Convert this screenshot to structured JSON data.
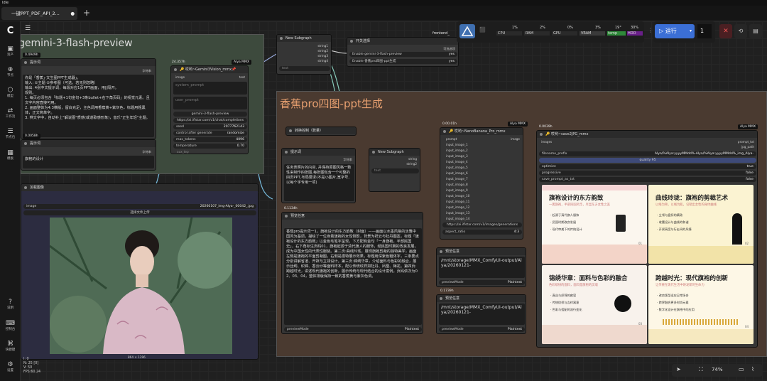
{
  "app": {
    "title": "Idle",
    "tab_label": "一键PPT_PDF_API_2...",
    "tab_dot": "●",
    "new_tab": "+"
  },
  "sidebar": {
    "logo": "C",
    "items": [
      {
        "label": "资产",
        "icon": "▣"
      },
      {
        "label": "节点",
        "icon": "⊕"
      },
      {
        "label": "模型",
        "icon": "⬡"
      },
      {
        "label": "工作流",
        "icon": "⇄"
      },
      {
        "label": "节点包",
        "icon": "☰"
      },
      {
        "label": "模板",
        "icon": "▦"
      },
      {
        "label": "说明",
        "icon": "?"
      },
      {
        "label": "控制台",
        "icon": "⌨"
      },
      {
        "label": "快捷键",
        "icon": "⌘"
      },
      {
        "label": "设置",
        "icon": "⚙"
      }
    ]
  },
  "topbar": {
    "workflow_name": "frontend_",
    "stats": {
      "cpu": "1%",
      "cpu_label": "CPU",
      "ram": "2%",
      "ram_label": "RAM",
      "gpu": "0%",
      "gpu_label": "GPU",
      "vram": "3%",
      "vram_label": "VRAM",
      "temp": "19°",
      "temp_label": "temp",
      "hdd": "30%",
      "hdd_label": "HDD"
    },
    "run_label": "运行",
    "run_count": "1"
  },
  "groups": {
    "gemini_title": "gemini-3-flash-preview",
    "banana_title": "香蕉pro四图-ppt生成"
  },
  "nodes": {
    "prompt1": {
      "title": "提示词",
      "badge": "0.4949h",
      "port": "字符串",
      "text": "你是「香蕉」·文生图PPT生成器」。\n输入: ①主题 ②参考图（可选，若无则忽略）\n输出: 4张中文提示词，每段对应1页PPT画面，用||隔开。\n规则。\n1. 每页必须包含「标题+1句金句+3条bullet+右下角页码」的视觉元素。且文字内容直接可用。\n2. 画面整体为4:3横版，留白充足，主色调用香蕉黄+紫灰色，标题用粗黑体，正文简单字。\n3. 辨文字中，自动补上\"解说图\"质感(或道歌感形象)，音乐\"正生年轻\"主题。"
    },
    "prompt2": {
      "title": "提示词",
      "badge": "0.0058h",
      "port": "字符串",
      "text": "旗袍的设计"
    },
    "gemini": {
      "title": "🔑 哎哟~Gemini3Vision_mmx📌",
      "badge": "Alya MMX",
      "port_in": "image",
      "port_out": "text",
      "sys_placeholder": "system_prompt",
      "user_placeholder": "user_prompt",
      "model": "gemini-3-flash-preview",
      "url": "https://ai.iflstar.com/v1/chat/completions",
      "seed_label": "seed",
      "seed": "2077762143",
      "ctrl_label": "control after generate",
      "ctrl": "randomize",
      "tokens_label": "max_tokens",
      "tokens": "4096",
      "temp_label": "temperature",
      "temp": "0.70",
      "aux_label": "aux_tep",
      "time": "24.357h"
    },
    "subgraph1": {
      "title": "New Subgraph",
      "ports": [
        "string1",
        "string2",
        "string3",
        "string4"
      ],
      "out": "text"
    },
    "switch": {
      "title": "开关选择",
      "badge": "可选选项",
      "opt1_label": "Enable gemini-3-flash-preview",
      "opt1": "yes",
      "opt2_label": "Enable 香蕉pro四图-ppt生成",
      "opt2": "yes"
    },
    "loadimg": {
      "title": "加载图像",
      "file_label": "image",
      "file": "20260107_img-Alya-_00042_.jpg",
      "upload": "选择文件上传",
      "footer": "864 × 1296"
    },
    "conv": {
      "title": "转换控制（数量）"
    },
    "prompt3": {
      "title": "提示词",
      "port": "字符串",
      "text": "任务表照片的内容, 并保持原图风格一致性来制作四张图,每张图包含一个可整的四页PPT,布局要求(不是小图片,宽字号,以每个字专用一项)"
    },
    "subgraph2": {
      "title": "New Subgraph",
      "ports": [
        "string",
        "string2"
      ],
      "out": "text"
    },
    "banana": {
      "title": "🔑 哎哟~NanoBanana_Pro_mmx",
      "badge": "Alya MMX",
      "badge2": "0.00.01h",
      "ports": [
        "prompt",
        "input_image_1",
        "input_image_2",
        "input_image_3",
        "input_image_4",
        "input_image_5",
        "input_image_6",
        "input_image_7",
        "input_image_8",
        "input_image_9",
        "input_image_10",
        "input_image_11",
        "input_image_12",
        "input_image_13",
        "input_image_14"
      ],
      "out": "image",
      "url": "https://ai.iflstar.com/v1/images/generations",
      "aspect_label": "aspect_ratio",
      "aspect": "4:3"
    },
    "preview1": {
      "title": "预览任意",
      "badge": "0.1134h",
      "text": "香蕉pro提示词一1，旗袍设计的东方韵致（封面）——画面以水墨风格的淡雅中国风为基调，描绘了一位身着旗袍的女性侧影，背景为祥云与牡丹图案，标题「旗袍设计的东方韵致」以金色毛笔字呈现，下方配有金句「一身旗袍，半部民国史」，右下角标注页码01，旗袍起源于清代旗人的服饰，经民国时期的改良发展，成为中国女性的代表性服装。第二页:曲线玲珑，展现旗袍剪裁的独特美学，画面左侧是旗袍的平面剪裁图，右侧是模特展示效果，标题用深紫色粗体字，三条要点分别讲解省道、开衩与立领设计。第三页:锦绣华章，介绍面料与色彩的融合，展示丝绸、织锦、香云纱等面料样本，配以传统纹样如牡丹、凤凰、梅花。第四页:跨越时光，讲述现代旗袍的创新，展示传统与现代结合的设计案例。页码依次为02、03、04，整体排版保持一致的香蕉黄与紫灰色调。",
      "footer_label": "previewMode",
      "footer_val": "Plaintext"
    },
    "preview2": {
      "title": "预览任意",
      "text": "/mnt/storage/MMX_ComfyUI-output/Alya/20260121-",
      "footer_label": "previewMode",
      "footer_val": "Plaintext"
    },
    "preview3": {
      "title": "预览任意",
      "badge": "0.1739h",
      "text": "/mnt/storage/MMX_ComfyUI-output/Alya/20260121-",
      "footer_label": "previewMode",
      "footer_val": "Plaintext"
    },
    "save": {
      "title": "🔑 哎哟~save2JPG_mmx",
      "badge": "Alya MMX",
      "badge2": "0.0039h",
      "port_in": "images",
      "port_out1": "prompt_txt",
      "port_out2": "jpg_path",
      "prefix_label": "filename_prefix",
      "prefix": "Alya/%Alya:yyyyMMdd%-Alya/%Alya:yyyyMMdd%_img_Alya-",
      "quality_label": "quality",
      "quality": "95",
      "optimize_label": "optimize",
      "optimize": "true",
      "progressive_label": "progressive",
      "progressive": "false",
      "saveprompt_label": "save_prompt_as_txt",
      "saveprompt": "false"
    }
  },
  "ppt": {
    "s1": {
      "title": "旗袍设计的东方韵致",
      "sub": "一袭旗袍，半部民国风华，尽显东方女性之美",
      "b": [
        "· 起源于清代旗人服饰",
        "· 民国时期改良发展",
        "· 现代审美下的传统设计"
      ],
      "num": "01"
    },
    "s2": {
      "title": "曲线玲珑：旗袍的剪裁艺术",
      "sub": "以线为骨，以线为肌，勾勒出女性的身体曲线",
      "b": [
        "· 立领与盘扣的精致",
        "· 收腰设计与曲线的和谐",
        "· 开衩高度与行走间的风情"
      ],
      "num": "02"
    },
    "s3": {
      "title": "锦绣华章：面料与色彩的融合",
      "sub": "色彩缤纷的面料，面料是旗袍的灵魂",
      "b": [
        "· 真丝与织锦的雍容",
        "· 传统纹样与吉祥寓意",
        "· 色彩与搭配的流行变化"
      ],
      "num": "03"
    },
    "s4": {
      "title": "跨越时光：现代旗袍的创新",
      "sub": "让传统在现代生活中焕发新的生命力",
      "b": [
        "· 改良版型适应日常场合",
        "· 跨界融合更多时尚元素",
        "· 数字化设计在旗袍中的应用"
      ],
      "num": "04"
    }
  },
  "left_stats": {
    "i": "I: 0",
    "n": "N: 25 [0]",
    "v": "V: 50",
    "fps": "FPS:60.24"
  },
  "zoom": "74%"
}
